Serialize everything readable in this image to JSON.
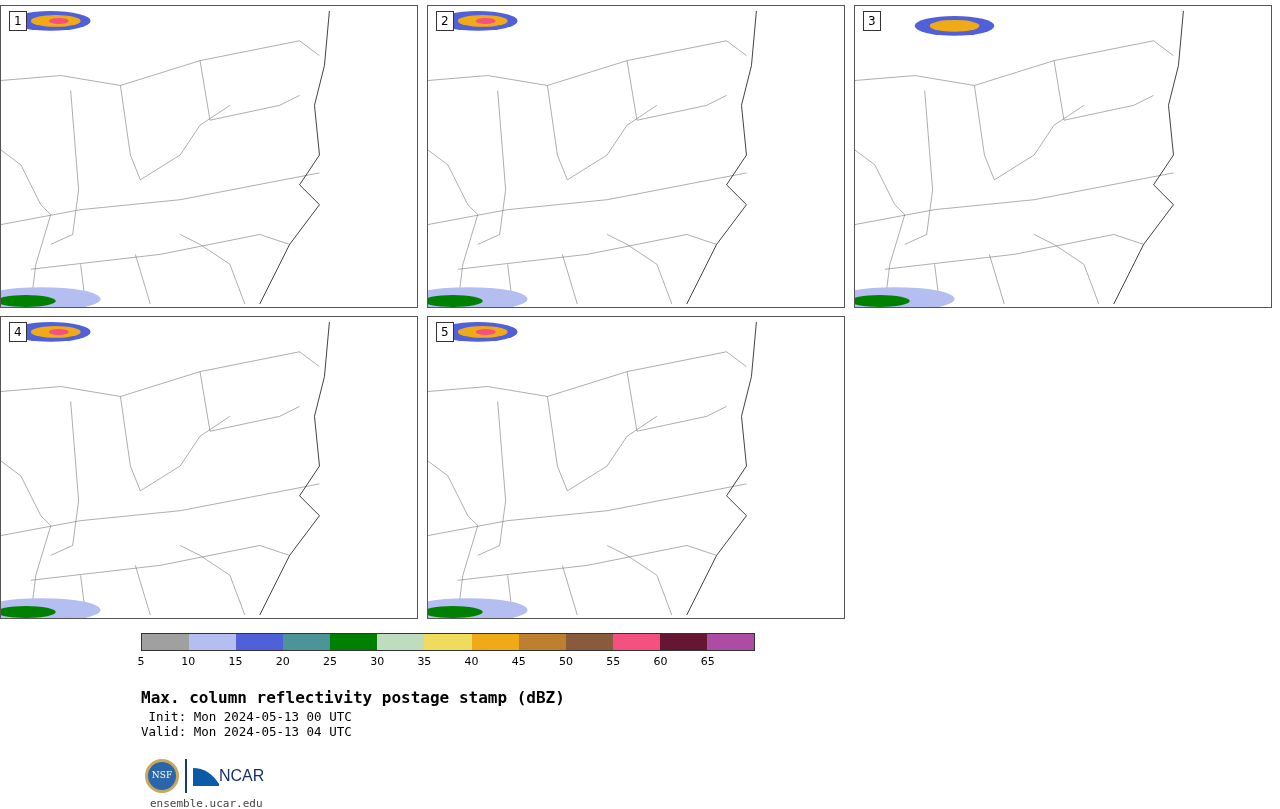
{
  "panels": [
    {
      "label": "1"
    },
    {
      "label": "2"
    },
    {
      "label": "3"
    },
    {
      "label": "4"
    },
    {
      "label": "5"
    }
  ],
  "colorbar": {
    "bins": [
      {
        "color": "#a0a0a0"
      },
      {
        "color": "#b4bef0"
      },
      {
        "color": "#5060d8"
      },
      {
        "color": "#4c9498"
      },
      {
        "color": "#008000"
      },
      {
        "color": "#bfdcbf"
      },
      {
        "color": "#f0dc5c"
      },
      {
        "color": "#f0aa18"
      },
      {
        "color": "#bc8030"
      },
      {
        "color": "#8a5a3c"
      },
      {
        "color": "#f45080"
      },
      {
        "color": "#641632"
      },
      {
        "color": "#ac4ca4"
      }
    ],
    "ticks": [
      "5",
      "10",
      "15",
      "20",
      "25",
      "30",
      "35",
      "40",
      "45",
      "50",
      "55",
      "60",
      "65"
    ]
  },
  "title": "Max. column reflectivity postage stamp (dBZ)",
  "init": " Init: Mon 2024-05-13 00 UTC",
  "valid": "Valid: Mon 2024-05-13 04 UTC",
  "logo": {
    "text": "NCAR",
    "seal": "NSF"
  },
  "url": "ensemble.ucar.edu"
}
